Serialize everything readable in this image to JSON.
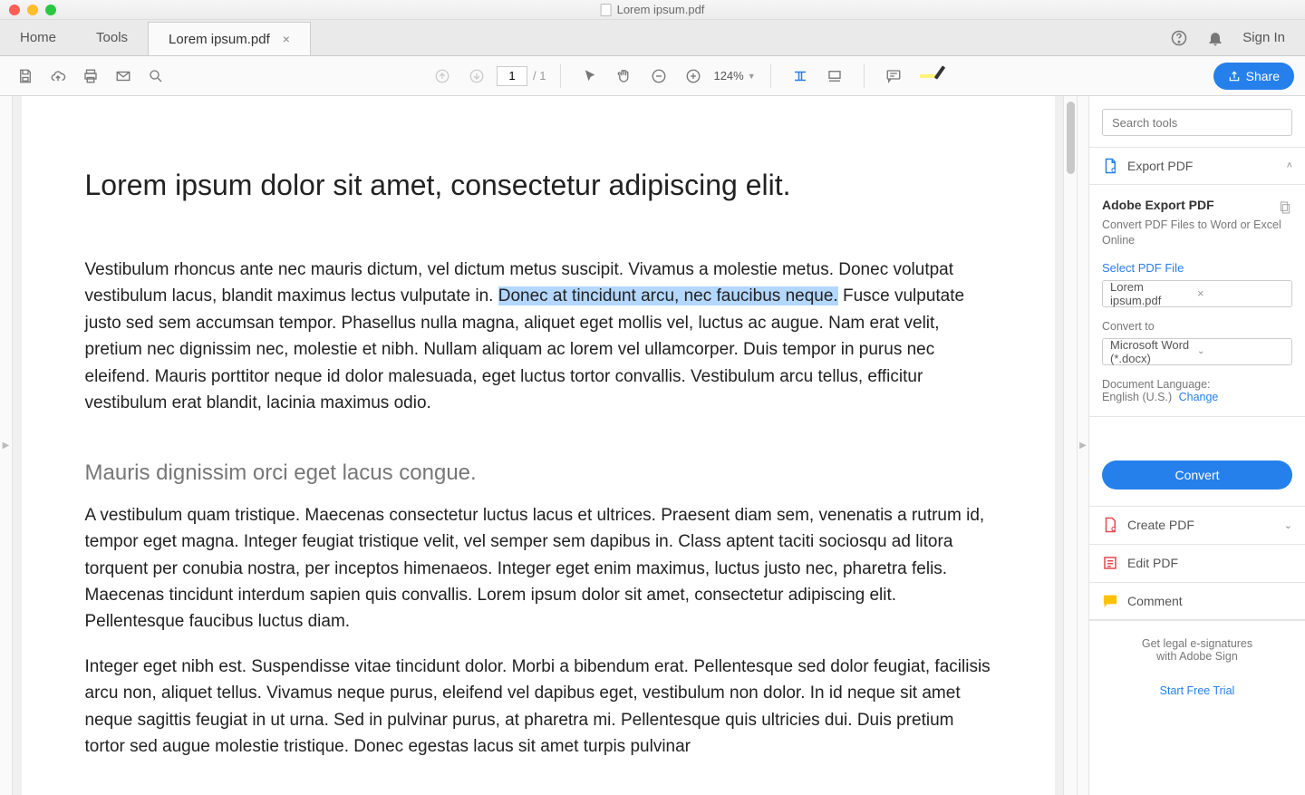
{
  "window": {
    "title": "Lorem ipsum.pdf"
  },
  "tabs": {
    "home": "Home",
    "tools": "Tools",
    "file": "Lorem ipsum.pdf",
    "signin": "Sign In"
  },
  "toolbar": {
    "page_current": "1",
    "page_total": "/  1",
    "zoom": "124%",
    "share": "Share"
  },
  "document": {
    "h1": "Lorem ipsum dolor sit amet, consectetur adipiscing elit.",
    "p1a": "Vestibulum rhoncus ante nec mauris dictum, vel dictum metus suscipit. Vivamus a molestie metus. Donec volutpat vestibulum lacus, blandit maximus lectus vulputate in. ",
    "p1_highlight": "Donec at tincidunt arcu, nec faucibus neque.",
    "p1b": " Fusce vulputate justo sed sem accumsan tempor. Phasellus nulla magna, aliquet eget mollis vel, luctus ac augue. Nam erat velit, pretium nec dignissim nec, molestie et nibh. Nullam aliquam ac lorem vel ullamcorper. Duis tempor in purus nec eleifend. Mauris porttitor neque id dolor malesuada, eget luctus tortor convallis. Vestibulum arcu tellus, efficitur vestibulum erat blandit, lacinia maximus odio.",
    "h2": "Mauris dignissim orci eget lacus congue.",
    "p2": "A vestibulum quam tristique. Maecenas consectetur luctus lacus et ultrices. Praesent diam sem, venenatis a rutrum id, tempor eget magna. Integer feugiat tristique velit, vel semper sem dapibus in. Class aptent taciti sociosqu ad litora torquent per conubia nostra, per inceptos himenaeos. Integer eget enim maximus, luctus justo nec, pharetra felis. Maecenas tincidunt interdum sapien quis convallis. Lorem ipsum dolor sit amet, consectetur adipiscing elit. Pellentesque faucibus luctus diam.",
    "p3": "Integer eget nibh est. Suspendisse vitae tincidunt dolor. Morbi a bibendum erat. Pellentesque sed dolor feugiat, facilisis arcu non, aliquet tellus. Vivamus neque purus, eleifend vel dapibus eget, vestibulum non dolor. In id neque sit amet neque sagittis feugiat in ut urna. Sed in pulvinar purus, at pharetra mi. Pellentesque quis ultricies dui. Duis pretium tortor sed augue molestie tristique. Donec egestas lacus sit amet turpis pulvinar"
  },
  "side": {
    "search_placeholder": "Search tools",
    "export_header": "Export PDF",
    "export_title": "Adobe Export PDF",
    "export_sub": "Convert PDF Files to Word or Excel Online",
    "select_file_label": "Select PDF File",
    "selected_file": "Lorem ipsum.pdf",
    "convert_to_label": "Convert to",
    "convert_to_value": "Microsoft Word (*.docx)",
    "lang_label": "Document Language:",
    "lang_value": "English (U.S.)",
    "lang_change": "Change",
    "convert_btn": "Convert",
    "create_pdf": "Create PDF",
    "edit_pdf": "Edit PDF",
    "comment": "Comment",
    "footer1": "Get legal e-signatures",
    "footer2": "with Adobe Sign",
    "trial": "Start Free Trial"
  }
}
